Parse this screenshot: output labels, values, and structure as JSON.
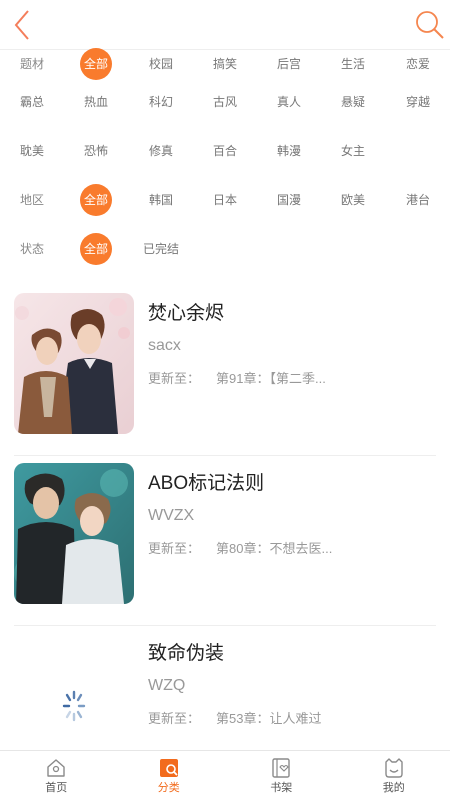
{
  "colors": {
    "accent": "#f97b2d",
    "text": "#222222",
    "muted": "#999999"
  },
  "header": {
    "back_icon": "chevron-left-icon",
    "search_icon": "search-icon"
  },
  "filters": {
    "genre": {
      "label": "题材",
      "options": [
        "全部",
        "校园",
        "搞笑",
        "后宫",
        "生活",
        "恋爱",
        "霸总",
        "热血",
        "科幻",
        "古风",
        "真人",
        "悬疑",
        "穿越",
        "耽美",
        "恐怖",
        "修真",
        "百合",
        "韩漫",
        "女主"
      ],
      "selected": "全部"
    },
    "region": {
      "label": "地区",
      "options": [
        "全部",
        "韩国",
        "日本",
        "国漫",
        "欧美",
        "港台"
      ],
      "selected": "全部"
    },
    "status": {
      "label": "状态",
      "options": [
        "全部",
        "已完结"
      ],
      "selected": "全部"
    }
  },
  "comics": [
    {
      "title": "焚心余烬",
      "author": "sacx",
      "update_label": "更新至：",
      "latest": "第91章：【第二季..."
    },
    {
      "title": "ABO标记法则",
      "author": "WVZX",
      "update_label": "更新至：",
      "latest": "第80章：不想去医..."
    },
    {
      "title": "致命伪装",
      "author": "WZQ",
      "update_label": "更新至：",
      "latest": "第53章：让人难过"
    }
  ],
  "tabbar": [
    {
      "label": "首页",
      "icon": "home-icon"
    },
    {
      "label": "分类",
      "icon": "category-icon",
      "active": true
    },
    {
      "label": "书架",
      "icon": "bookshelf-icon"
    },
    {
      "label": "我的",
      "icon": "profile-icon"
    }
  ]
}
